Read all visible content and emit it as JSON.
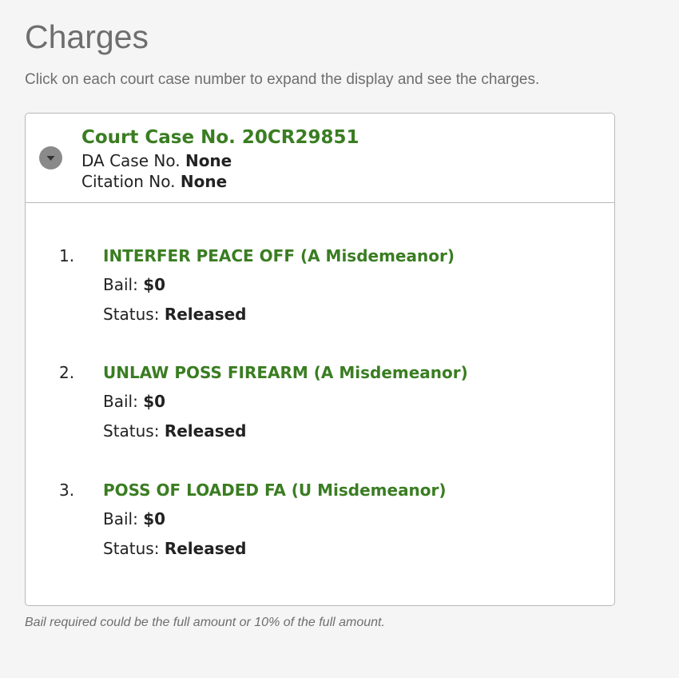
{
  "page": {
    "title": "Charges",
    "instructions": "Click on each court case number to expand the display and see the charges.",
    "footnote": "Bail required could be the full amount or 10% of the full amount."
  },
  "case": {
    "court_case_label": "Court Case No. 20CR29851",
    "da_case_label": "DA Case No.",
    "da_case_value": "None",
    "citation_label": "Citation No.",
    "citation_value": "None",
    "toggle_icon": "chevron-down-icon"
  },
  "charges": [
    {
      "index": "1.",
      "name": "INTERFER PEACE OFF (A Misdemeanor)",
      "bail_label": "Bail:",
      "bail_value": "$0",
      "status_label": "Status:",
      "status_value": "Released"
    },
    {
      "index": "2.",
      "name": "UNLAW POSS FIREARM (A Misdemeanor)",
      "bail_label": "Bail:",
      "bail_value": "$0",
      "status_label": "Status:",
      "status_value": "Released"
    },
    {
      "index": "3.",
      "name": "POSS OF LOADED FA (U Misdemeanor)",
      "bail_label": "Bail:",
      "bail_value": "$0",
      "status_label": "Status:",
      "status_value": "Released"
    }
  ],
  "colors": {
    "accent_green": "#3a7d22",
    "muted_text": "#6e6e6e",
    "border": "#b9b9b9",
    "background": "#f5f5f5"
  }
}
